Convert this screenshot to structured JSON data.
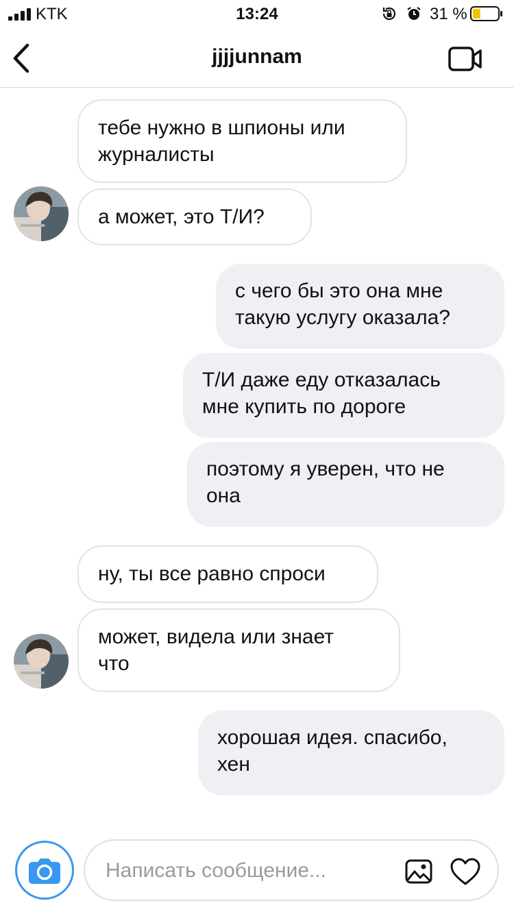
{
  "status_bar": {
    "carrier": "KTK",
    "time": "13:24",
    "battery_percent": "31 %",
    "battery_level": 0.31,
    "battery_color": "#f5c400"
  },
  "header": {
    "back_icon": "chevron-left-icon",
    "title": "jjjjunnam",
    "video_icon": "video-camera-icon"
  },
  "messages": [
    {
      "side": "in",
      "text": "тебе нужно в шпионы или\nжурналисты"
    },
    {
      "side": "in",
      "text": "а может, это Т/И?"
    },
    {
      "side": "out",
      "text": "с чего бы это она мне\nтакую услугу оказала?"
    },
    {
      "side": "out",
      "text": "Т/И даже еду отказалась\nмне купить по дороге"
    },
    {
      "side": "out",
      "text": "поэтому я уверен, что не\nона"
    },
    {
      "side": "in",
      "text": "ну, ты все равно спроси"
    },
    {
      "side": "in",
      "text": "может, видела или знает\nчто"
    },
    {
      "side": "out",
      "text": "хорошая идея. спасибо,\nхен"
    }
  ],
  "composer": {
    "placeholder": "Написать сообщение...",
    "camera_icon": "camera-icon",
    "gallery_icon": "image-gallery-icon",
    "heart_icon": "heart-icon",
    "accent_color": "#3897f0"
  }
}
